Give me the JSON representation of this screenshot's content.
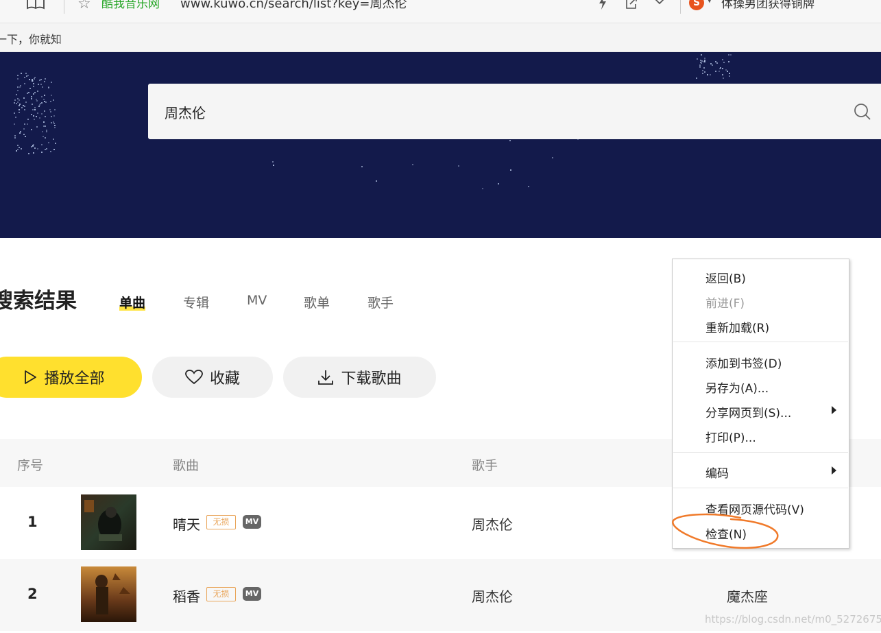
{
  "browser": {
    "site_name": "酷我音乐网",
    "url": "www.kuwo.cn/search/list?key=周杰伦",
    "hot_news": "体操男团获得铜牌",
    "bookmark_text": "一下，你就知"
  },
  "search": {
    "value": "周杰伦"
  },
  "results": {
    "title": "搜索结果",
    "tabs": [
      {
        "label": "单曲"
      },
      {
        "label": "专辑"
      },
      {
        "label": "MV"
      },
      {
        "label": "歌单"
      },
      {
        "label": "歌手"
      }
    ],
    "active_tab": "单曲"
  },
  "actions": {
    "play_all": "播放全部",
    "favorite": "收藏",
    "download": "下载歌曲"
  },
  "table": {
    "headers": [
      "序号",
      "歌曲",
      "歌手"
    ],
    "rows": [
      {
        "index": "1",
        "title": "晴天",
        "badge_lossless": "无损",
        "badge_mv": "MV",
        "artist": "周杰伦",
        "album": ""
      },
      {
        "index": "2",
        "title": "稻香",
        "badge_lossless": "无损",
        "badge_mv": "MV",
        "artist": "周杰伦",
        "album": "魔杰座"
      }
    ]
  },
  "context_menu": {
    "items": [
      {
        "label": "返回(B)",
        "disabled": false
      },
      {
        "label": "前进(F)",
        "disabled": true
      },
      {
        "label": "重新加载(R)",
        "disabled": false
      },
      {
        "label": "添加到书签(D)",
        "disabled": false
      },
      {
        "label": "另存为(A)...",
        "disabled": false
      },
      {
        "label": "分享网页到(S)...",
        "disabled": false,
        "submenu": true
      },
      {
        "label": "打印(P)...",
        "disabled": false
      },
      {
        "label": "编码",
        "disabled": false,
        "submenu": true
      },
      {
        "label": "查看网页源代码(V)",
        "disabled": false
      },
      {
        "label": "检查(N)",
        "disabled": false
      }
    ]
  },
  "watermark": "https://blog.csdn.net/m0_52726759",
  "colors": {
    "banner_bg": "#131a4b",
    "accent_yellow": "#ffe02e",
    "lossless_badge": "#e9a55a",
    "annotation": "#f07a2a"
  },
  "icons": [
    "star-icon",
    "bookmark-book-icon",
    "lightning-icon",
    "share-icon",
    "chevron-down-icon",
    "sogou-logo",
    "search-icon",
    "play-icon",
    "heart-icon",
    "download-icon",
    "submenu-arrow-icon"
  ]
}
